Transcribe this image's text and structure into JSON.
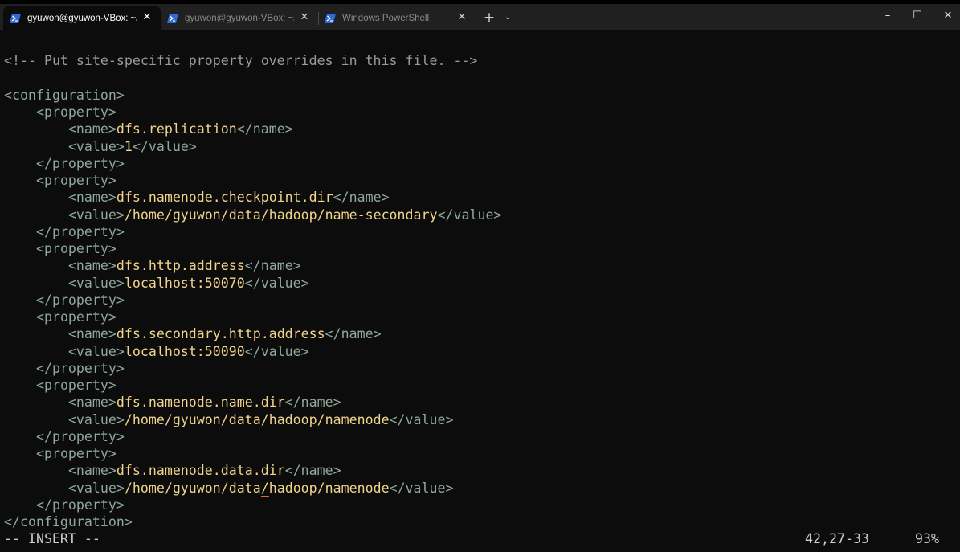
{
  "tabs": [
    {
      "label": "gyuwon@gyuwon-VBox: ~/h",
      "active": true,
      "icon": "powershell-icon"
    },
    {
      "label": "gyuwon@gyuwon-VBox: ~/da",
      "active": false,
      "icon": "powershell-icon"
    },
    {
      "label": "Windows PowerShell",
      "active": false,
      "icon": "powershell-icon"
    }
  ],
  "toolbar": {
    "new_tab": "+",
    "dropdown": "⌄"
  },
  "window_controls": {
    "minimize": "–",
    "maximize": "☐",
    "close": "✕"
  },
  "colors": {
    "tag": "#8fa89a",
    "text": "#f0d48a",
    "comment": "#9a9a9a",
    "cursor": "#e8602c"
  },
  "editor": {
    "comment": "<!-- Put site-specific property overrides in this file. -->",
    "config_open": "<configuration>",
    "config_close": "</configuration>",
    "prop_open": "<property>",
    "prop_close": "</property>",
    "name_open": "<name>",
    "name_close": "</name>",
    "value_open": "<value>",
    "value_close": "</value>",
    "properties": [
      {
        "name": "dfs.replication",
        "value": "1"
      },
      {
        "name": "dfs.namenode.checkpoint.dir",
        "value": "/home/gyuwon/data/hadoop/name-secondary"
      },
      {
        "name": "dfs.http.address",
        "value": "localhost:50070"
      },
      {
        "name": "dfs.secondary.http.address",
        "value": "localhost:50090"
      },
      {
        "name": "dfs.namenode.name.dir",
        "value": "/home/gyuwon/data/hadoop/namenode"
      },
      {
        "name": "dfs.namenode.data.dir",
        "value_before_cursor": "/home/gyuwon/data",
        "value_cursor_char": "/",
        "value_after_cursor": "hadoop/namenode"
      }
    ]
  },
  "status": {
    "mode": "-- INSERT --",
    "position": "42,27-33",
    "percent": "93%"
  }
}
